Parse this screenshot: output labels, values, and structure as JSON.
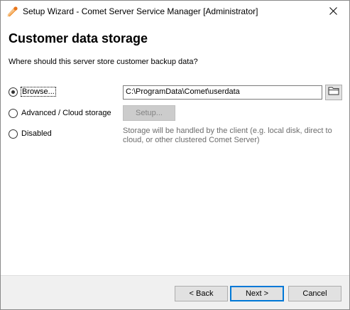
{
  "window": {
    "title": "Setup Wizard - Comet Server Service Manager [Administrator]",
    "close_glyph": "✕"
  },
  "page": {
    "heading": "Customer data storage",
    "question": "Where should this server store customer backup data?"
  },
  "options": [
    {
      "label": "Browse...",
      "checked": true
    },
    {
      "label": "Advanced / Cloud storage",
      "checked": false
    },
    {
      "label": "Disabled",
      "checked": false
    }
  ],
  "path": {
    "value": "C:\\ProgramData\\Comet\\userdata"
  },
  "setup_button": {
    "label": "Setup..."
  },
  "disabled_note": "Storage will be handled by the client (e.g. local disk, direct to cloud, or other clustered Comet Server)",
  "footer": {
    "back_label": "< Back",
    "next_label": "Next >",
    "cancel_label": "Cancel"
  },
  "icons": {
    "app": "comet-app-icon",
    "close": "close-icon",
    "folder": "folder-icon"
  },
  "colors": {
    "accent": "#0078d7",
    "comet_orange": "#f08a24"
  }
}
